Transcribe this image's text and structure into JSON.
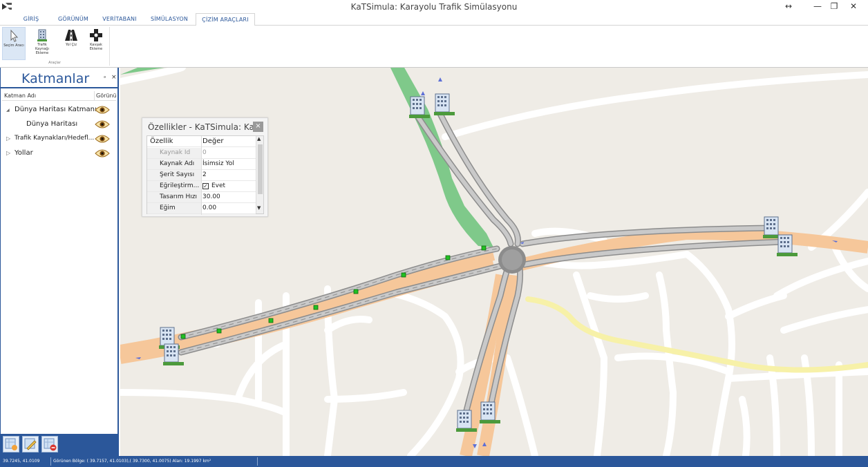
{
  "window": {
    "title": "KaTSimula: Karayolu Trafik Simülasyonu",
    "restore_glyph": "↔",
    "minimize_glyph": "—",
    "maximize_glyph": "❐",
    "close_glyph": "✕"
  },
  "ribbon": {
    "tabs": [
      {
        "label": "GİRİŞ",
        "active": false
      },
      {
        "label": "GÖRÜNÜM",
        "active": false
      },
      {
        "label": "VERİTABANI",
        "active": false
      },
      {
        "label": "SİMÜLASYON",
        "active": false
      },
      {
        "label": "ÇİZİM ARAÇLARI",
        "active": true
      }
    ],
    "buttons": [
      {
        "label": "Seçim Aracı",
        "icon": "cursor-icon",
        "selected": true
      },
      {
        "label": "Trafik Kaynağı Ekleme",
        "icon": "building-icon",
        "selected": false
      },
      {
        "label": "Yol Çiz",
        "icon": "road-icon",
        "selected": false
      },
      {
        "label": "Kavşak Ekleme",
        "icon": "junction-icon",
        "selected": false
      }
    ],
    "group_label": "Araçlar"
  },
  "layers_panel": {
    "title": "Katmanlar",
    "pin_glyph": "ᵃ",
    "close_glyph": "×",
    "columns": {
      "name": "Katman Adı",
      "visibility": "Görünü"
    },
    "rows": [
      {
        "name": "Dünya Haritası Katmanı",
        "expander": "◢",
        "visible": true
      },
      {
        "name": "Dünya Haritası",
        "expander": "",
        "visible": true
      },
      {
        "name": "Trafik Kaynakları/Hedefl...",
        "expander": "▷",
        "visible": true
      },
      {
        "name": "Yollar",
        "expander": "▷",
        "visible": true
      }
    ]
  },
  "properties": {
    "title": "Özellikler - KaTSimula: Ka...",
    "close_glyph": "×",
    "headers": {
      "key": "Özellik",
      "value": "Değer"
    },
    "rows": [
      {
        "key": "Kaynak Id",
        "value": "0",
        "readonly": true
      },
      {
        "key": "Kaynak Adı",
        "value": "İsimsiz Yol",
        "readonly": false
      },
      {
        "key": "Şerit Sayısı",
        "value": "2",
        "readonly": false
      },
      {
        "key": "Eğrileştirm...",
        "value": "Evet",
        "checkbox": true,
        "readonly": false
      },
      {
        "key": "Tasarım Hızı",
        "value": "30.00",
        "readonly": false
      },
      {
        "key": "Eğim",
        "value": "0.00",
        "readonly": false
      }
    ]
  },
  "statusbar": {
    "coords": "39.7245,  41.0109",
    "view": "Görünen Bölge: ( 39.7157, 41.0103),( 39.7300, 41.0075) Alan: 19.1997 km²"
  },
  "colors": {
    "accent": "#2b579a",
    "map_bg": "#efece6",
    "major_road": "#f6c79a",
    "sim_road": "#9c9c9c",
    "green_area": "#7fc98a",
    "yellow_road": "#f7f1a8"
  }
}
